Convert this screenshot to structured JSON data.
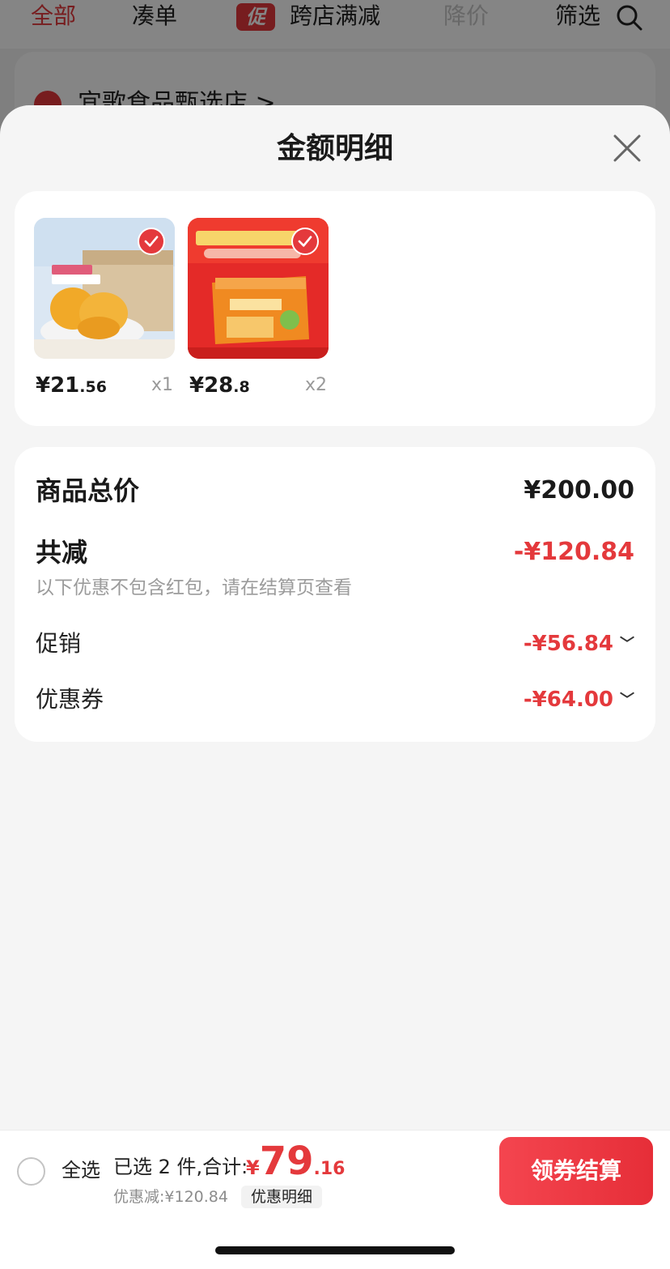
{
  "background": {
    "tabs": [
      "全部",
      "凑单",
      "跨店满减",
      "降价",
      "筛选"
    ],
    "promo_badge": "促",
    "store_name": "宜歌食品甄选店 >"
  },
  "sheet": {
    "title": "金额明细",
    "products": [
      {
        "price_int": "¥21",
        "price_dec": ".56",
        "qty": "x1"
      },
      {
        "price_int": "¥28",
        "price_dec": ".8",
        "qty": "x2"
      }
    ],
    "summary": {
      "total_label": "商品总价",
      "total_value": "¥200.00",
      "reduce_label": "共减",
      "reduce_value": "-¥120.84",
      "note": "以下优惠不包含红包，请在结算页查看",
      "promo_label": "促销",
      "promo_value": "-¥56.84",
      "coupon_label": "优惠券",
      "coupon_value": "-¥64.00"
    }
  },
  "bottom_bar": {
    "select_all": "全选",
    "selected_text": "已选 2 件,合计:",
    "total_currency": "¥",
    "total_int": "79",
    "total_dec": ".16",
    "discount_text": "优惠减:¥120.84",
    "detail_button": "优惠明细",
    "checkout_button": "领券结算"
  },
  "colors": {
    "accent": "#e4393c"
  },
  "icons": {
    "close": "close-icon",
    "search": "search-icon",
    "check": "check-icon",
    "chevron": "chevron-down-icon"
  }
}
